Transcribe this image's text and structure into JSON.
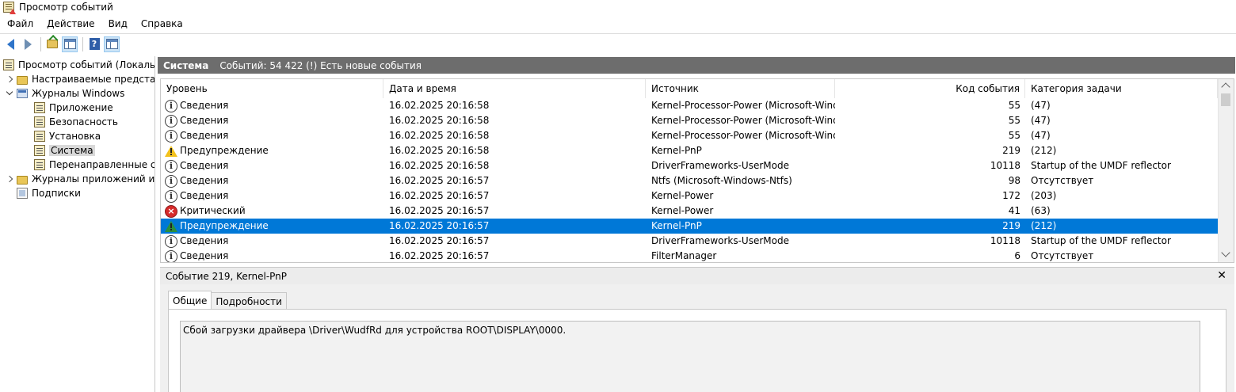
{
  "window": {
    "title": "Просмотр событий"
  },
  "menu": [
    "Файл",
    "Действие",
    "Вид",
    "Справка"
  ],
  "toolbar": {
    "buttons": [
      "back-icon",
      "forward-icon",
      "open-folder-icon",
      "console-tree-icon",
      "help-icon",
      "action-pane-icon"
    ]
  },
  "tree": {
    "root": "Просмотр событий (Локальны",
    "custom_views": "Настраиваемые представле",
    "windows_logs": "Журналы Windows",
    "app_log": "Приложение",
    "security_log": "Безопасность",
    "setup_log": "Установка",
    "system_log": "Система",
    "forwarded_log": "Перенаправленные соб",
    "app_services": "Журналы приложений и сл",
    "subscriptions": "Подписки"
  },
  "section": {
    "title": "Система",
    "subtitle": "Событий: 54 422 (!) Есть новые события"
  },
  "table": {
    "columns": [
      "Уровень",
      "Дата и время",
      "Источник",
      "Код события",
      "Категория задачи"
    ],
    "rows": [
      {
        "level": "Сведения",
        "icon": "info",
        "datetime": "16.02.2025 20:16:58",
        "source": "Kernel-Processor-Power (Microsoft-Wind...",
        "code": "55",
        "category": "(47)"
      },
      {
        "level": "Сведения",
        "icon": "info",
        "datetime": "16.02.2025 20:16:58",
        "source": "Kernel-Processor-Power (Microsoft-Wind...",
        "code": "55",
        "category": "(47)"
      },
      {
        "level": "Сведения",
        "icon": "info",
        "datetime": "16.02.2025 20:16:58",
        "source": "Kernel-Processor-Power (Microsoft-Wind...",
        "code": "55",
        "category": "(47)"
      },
      {
        "level": "Предупреждение",
        "icon": "warning",
        "datetime": "16.02.2025 20:16:58",
        "source": "Kernel-PnP",
        "code": "219",
        "category": "(212)"
      },
      {
        "level": "Сведения",
        "icon": "info",
        "datetime": "16.02.2025 20:16:58",
        "source": "DriverFrameworks-UserMode",
        "code": "10118",
        "category": "Startup of the UMDF reflector"
      },
      {
        "level": "Сведения",
        "icon": "info",
        "datetime": "16.02.2025 20:16:57",
        "source": "Ntfs (Microsoft-Windows-Ntfs)",
        "code": "98",
        "category": "Отсутствует"
      },
      {
        "level": "Сведения",
        "icon": "info",
        "datetime": "16.02.2025 20:16:57",
        "source": "Kernel-Power",
        "code": "172",
        "category": "(203)"
      },
      {
        "level": "Критический",
        "icon": "critical",
        "datetime": "16.02.2025 20:16:57",
        "source": "Kernel-Power",
        "code": "41",
        "category": "(63)"
      },
      {
        "level": "Предупреждение",
        "icon": "warning",
        "datetime": "16.02.2025 20:16:57",
        "source": "Kernel-PnP",
        "code": "219",
        "category": "(212)",
        "selected": true
      },
      {
        "level": "Сведения",
        "icon": "info",
        "datetime": "16.02.2025 20:16:57",
        "source": "DriverFrameworks-UserMode",
        "code": "10118",
        "category": "Startup of the UMDF reflector"
      },
      {
        "level": "Сведения",
        "icon": "info",
        "datetime": "16.02.2025 20:16:57",
        "source": "FilterManager",
        "code": "6",
        "category": "Отсутствует"
      }
    ]
  },
  "detail": {
    "title": "Событие 219, Kernel-PnP",
    "close": "✕",
    "tabs": [
      "Общие",
      "Подробности"
    ],
    "message": "Сбой загрузки драйвера \\Driver\\WudfRd для устройства ROOT\\DISPLAY\\0000."
  },
  "colors": {
    "selection": "#0078d7",
    "header_bar": "#6d6d6d",
    "warning": "#f2c11c",
    "critical": "#d62b2b"
  }
}
